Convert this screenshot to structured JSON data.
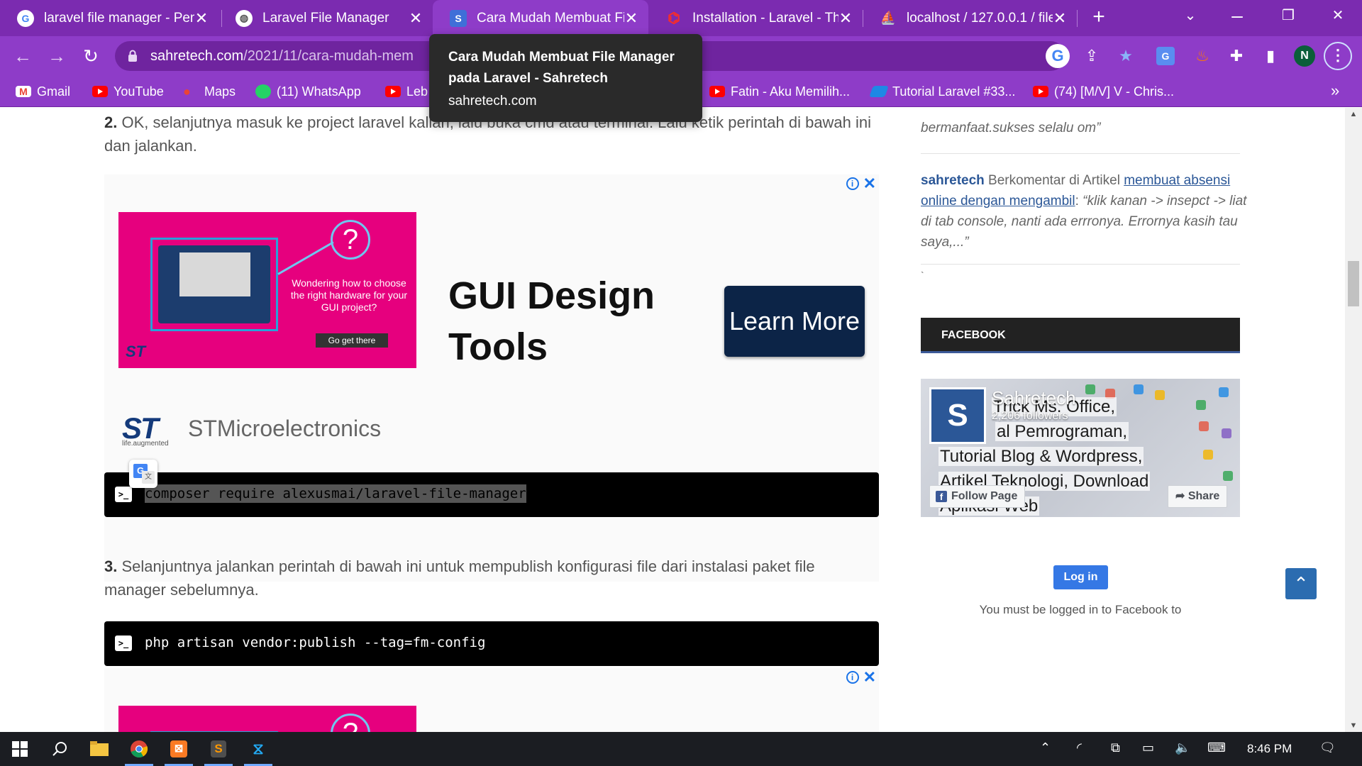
{
  "tabs": [
    {
      "title": "laravel file manager - Pen",
      "icon": "google-icon",
      "active": false
    },
    {
      "title": "Laravel File Manager",
      "icon": "globe-icon",
      "active": false
    },
    {
      "title": "Cara Mudah Membuat Fil",
      "icon": "sahretech-icon",
      "active": true
    },
    {
      "title": "Installation - Laravel - The",
      "icon": "laravel-icon",
      "active": false
    },
    {
      "title": "localhost / 127.0.0.1 / file",
      "icon": "phpmyadmin-icon",
      "active": false
    }
  ],
  "tooltip": {
    "title": "Cara Mudah Membuat File Manager pada Laravel - Sahretech",
    "host": "sahretech.com"
  },
  "address": {
    "host": "sahretech.com",
    "path": "/2021/11/cara-mudah-mem"
  },
  "profile_initial": "N",
  "bookmarks": [
    {
      "label": "Gmail",
      "icon": "gmail-icon"
    },
    {
      "label": "YouTube",
      "icon": "youtube-icon"
    },
    {
      "label": "Maps",
      "icon": "maps-icon"
    },
    {
      "label": "(11) WhatsApp",
      "icon": "whatsapp-icon"
    },
    {
      "label": "Leb",
      "icon": "youtube-icon"
    },
    {
      "label": "Fatin - Aku Memilih...",
      "icon": "youtube-icon"
    },
    {
      "label": "Tutorial Laravel #33...",
      "icon": "wordpress-icon"
    },
    {
      "label": "(74) [M/V] V - Chris...",
      "icon": "youtube-icon"
    }
  ],
  "article": {
    "step2_num": "2.",
    "step2_text": " OK, selanjutnya masuk ke project laravel kalian, lalu buka cmd atau terminal. Lalu ketik perintah di bawah ini dan jalankan.",
    "cmd1": "composer require alexusmai/laravel-file-manager",
    "step3_num": "3.",
    "step3_text": " Selanjuntnya jalankan perintah di bawah ini untuk mempublish konfigurasi file dari instalasi paket file manager sebelumnya.",
    "cmd2": "php artisan vendor:publish --tag=fm-config"
  },
  "ad": {
    "bubble": "?",
    "blurb": "Wondering how to choose the right hardware for your GUI project?",
    "go": "Go get there",
    "headline": "GUI Design Tools",
    "cta": "Learn More",
    "logo": "ST",
    "tagline": "life.augmented",
    "brand": "STMicroelectronics"
  },
  "sidebar": {
    "quote1": "bermanfaat.sukses selalu om”",
    "comment": {
      "author": "sahretech",
      "middle": " Berkomentar di Artikel ",
      "link": "membuat absensi online dengan mengambil",
      "colon": ": ",
      "quote": "“klik kanan -> insepct -> liat di tab console, nanti ada errronya. Errornya kasih tau saya,...”"
    },
    "backtick": "`",
    "facebook_heading": "FACEBOOK",
    "fb": {
      "avatar": "S",
      "name": "Sahretech",
      "followers": "2,206 followers",
      "cover_lines": [
        "Trick Ms. Office,",
        "al Pemrograman,",
        "Tutorial Blog & Wordpress,",
        "Artikel Teknologi, Download",
        "Aplikasi Web"
      ],
      "follow": "Follow Page",
      "share": "Share",
      "login": "Log in",
      "note": "You must be logged in to Facebook to"
    }
  },
  "taskbar": {
    "time": "8:46 PM"
  }
}
